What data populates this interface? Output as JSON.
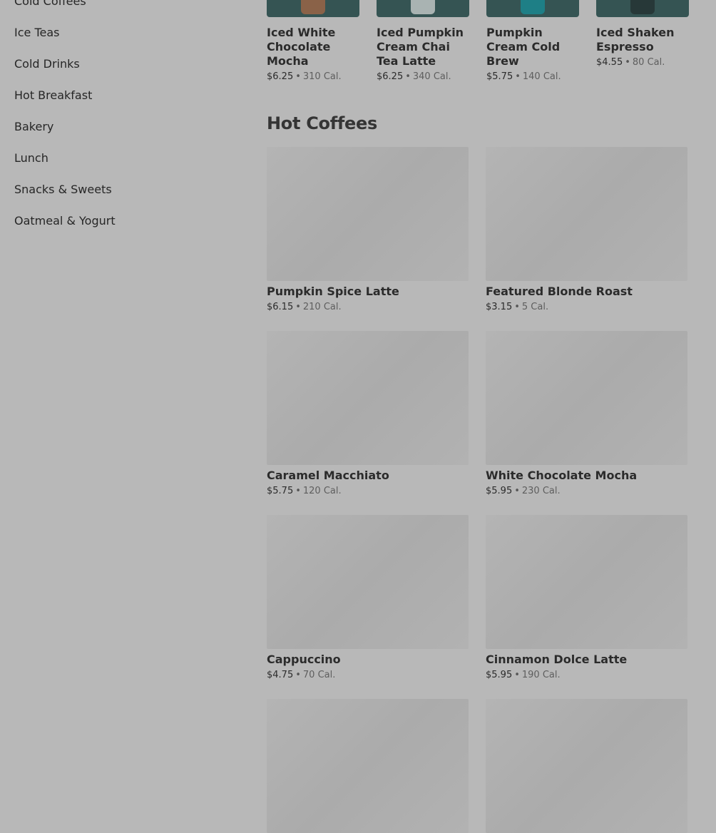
{
  "sidebar": {
    "items": [
      {
        "label": "Cold Coffees"
      },
      {
        "label": "Ice Teas"
      },
      {
        "label": "Cold Drinks"
      },
      {
        "label": "Hot Breakfast"
      },
      {
        "label": "Bakery"
      },
      {
        "label": "Lunch"
      },
      {
        "label": "Snacks & Sweets"
      },
      {
        "label": "Oatmeal & Yogurt"
      }
    ]
  },
  "top_products": [
    {
      "name": "Iced White Chocolate Mocha",
      "price": "$6.25",
      "calories": "310 Cal.",
      "thumb_color": "#355453",
      "drink_color": "#8a6248"
    },
    {
      "name": "Iced Pumpkin Cream Chai Tea Latte",
      "price": "$6.25",
      "calories": "340 Cal.",
      "thumb_color": "#355453",
      "drink_color": "#a9b3b2"
    },
    {
      "name": "Pumpkin Cream Cold Brew",
      "price": "$5.75",
      "calories": "140 Cal.",
      "thumb_color": "#355453",
      "drink_color": "#1e7f86"
    },
    {
      "name": "Iced Shaken Espresso",
      "price": "$4.55",
      "calories": "80 Cal.",
      "thumb_color": "#355453",
      "drink_color": "#273838"
    }
  ],
  "separator": "•",
  "section": {
    "title": "Hot Coffees",
    "products": [
      {
        "name": "Pumpkin Spice Latte",
        "price": "$6.15",
        "calories": "210 Cal."
      },
      {
        "name": "Featured Blonde Roast",
        "price": "$3.15",
        "calories": "5 Cal."
      },
      {
        "name": "Caramel Macchiato",
        "price": "$5.75",
        "calories": "120 Cal."
      },
      {
        "name": "White Chocolate Mocha",
        "price": "$5.95",
        "calories": "230 Cal."
      },
      {
        "name": "Cappuccino",
        "price": "$4.75",
        "calories": "70 Cal."
      },
      {
        "name": "Cinnamon Dolce Latte",
        "price": "$5.95",
        "calories": "190 Cal."
      },
      {
        "name": "",
        "price": "",
        "calories": ""
      },
      {
        "name": "",
        "price": "",
        "calories": ""
      }
    ]
  }
}
